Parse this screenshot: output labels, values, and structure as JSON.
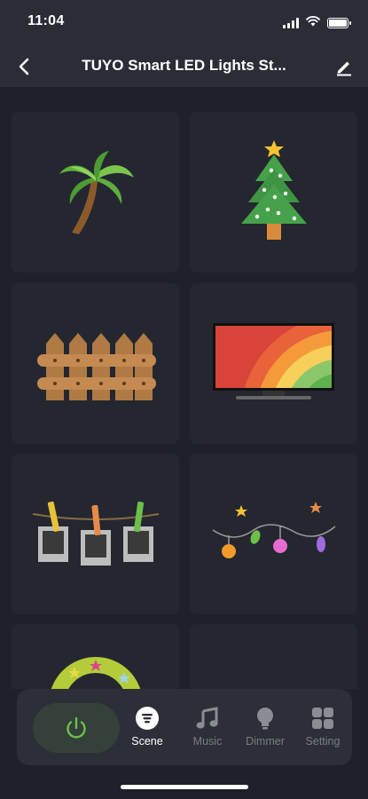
{
  "status_bar": {
    "time": "11:04",
    "icons": [
      "signal-icon",
      "wifi-icon",
      "battery-icon"
    ]
  },
  "nav": {
    "title": "TUYO Smart LED Lights St...",
    "back_icon": "chevron-left-icon",
    "edit_icon": "pencil-icon"
  },
  "scenes": [
    {
      "name": "palm-tree",
      "icon": "palm-tree-icon"
    },
    {
      "name": "christmas-tree",
      "icon": "christmas-tree-icon"
    },
    {
      "name": "fence",
      "icon": "fence-icon"
    },
    {
      "name": "rainbow-tv",
      "icon": "rainbow-tv-icon"
    },
    {
      "name": "photo-clothesline",
      "icon": "photo-clothesline-icon"
    },
    {
      "name": "string-lights",
      "icon": "string-lights-icon"
    },
    {
      "name": "wreath",
      "icon": "wreath-icon"
    },
    {
      "name": "empty",
      "icon": ""
    }
  ],
  "bottom_bar": {
    "power_icon": "power-icon",
    "tabs": [
      {
        "label": "Scene",
        "icon": "scene-icon",
        "active": true
      },
      {
        "label": "Music",
        "icon": "music-icon",
        "active": false
      },
      {
        "label": "Dimmer",
        "icon": "bulb-icon",
        "active": false
      },
      {
        "label": "Setting",
        "icon": "grid-icon",
        "active": false
      }
    ]
  },
  "colors": {
    "background": "#1e2129",
    "bar": "#2a2d35",
    "tile": "#24272f",
    "power_accent": "#6cc04a",
    "inactive_tab": "#7a7d84"
  }
}
